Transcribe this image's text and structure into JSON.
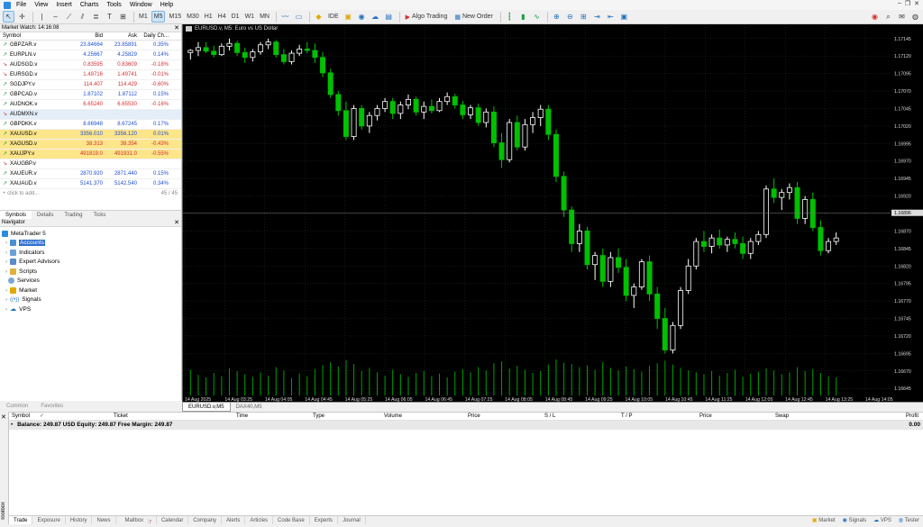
{
  "menu": [
    "File",
    "View",
    "Insert",
    "Charts",
    "Tools",
    "Window",
    "Help"
  ],
  "toolbar": {
    "timeframes": [
      "M1",
      "M5",
      "M15",
      "M30",
      "H1",
      "H4",
      "D1",
      "W1",
      "MN"
    ],
    "active_timeframe": "M5",
    "ide_label": "IDE",
    "algo_label": "Algo Trading",
    "neworder_label": "New Order"
  },
  "market_watch": {
    "title": "Market Watch: 14:16:08",
    "headers": {
      "symbol": "Symbol",
      "bid": "Bid",
      "ask": "Ask",
      "change": "Daily Ch..."
    },
    "rows": [
      {
        "symbol": "GBPZAR.v",
        "bid": "23.84664",
        "ask": "23.85891",
        "change": "0.35%",
        "dir": "up",
        "style": ""
      },
      {
        "symbol": "EURPLN.v",
        "bid": "4.25667",
        "ask": "4.25829",
        "change": "0.14%",
        "dir": "up",
        "style": ""
      },
      {
        "symbol": "AUDSGD.v",
        "bid": "0.83595",
        "ask": "0.83609",
        "change": "-0.18%",
        "dir": "dn",
        "style": ""
      },
      {
        "symbol": "EURSGD.v",
        "bid": "1.49716",
        "ask": "1.49741",
        "change": "-0.01%",
        "dir": "dn",
        "style": ""
      },
      {
        "symbol": "SGDJPY.v",
        "bid": "114.407",
        "ask": "114.429",
        "change": "-0.60%",
        "dir": "up",
        "style": ""
      },
      {
        "symbol": "GBPCAD.v",
        "bid": "1.87102",
        "ask": "1.87112",
        "change": "0.15%",
        "dir": "up",
        "style": ""
      },
      {
        "symbol": "AUDNOK.v",
        "bid": "6.65240",
        "ask": "6.65530",
        "change": "-0.16%",
        "dir": "up",
        "style": ""
      },
      {
        "symbol": "AUDMXN.v",
        "bid": "",
        "ask": "",
        "change": "",
        "dir": "dn",
        "style": "b"
      },
      {
        "symbol": "GBPDKK.v",
        "bid": "8.66948",
        "ask": "8.67245",
        "change": "0.17%",
        "dir": "up",
        "style": ""
      },
      {
        "symbol": "XAUUSD.v",
        "bid": "3356.010",
        "ask": "3356.120",
        "change": "0.01%",
        "dir": "up",
        "style": "y"
      },
      {
        "symbol": "XAGUSD.v",
        "bid": "38.313",
        "ask": "38.354",
        "change": "-0.43%",
        "dir": "up",
        "style": "y"
      },
      {
        "symbol": "XAUJPY.v",
        "bid": "491819.0",
        "ask": "491931.0",
        "change": "-0.55%",
        "dir": "up",
        "style": "y"
      },
      {
        "symbol": "XAUGBP.v",
        "bid": "",
        "ask": "",
        "change": "",
        "dir": "dn",
        "style": ""
      },
      {
        "symbol": "XAUEUR.v",
        "bid": "2870.920",
        "ask": "2871.440",
        "change": "0.15%",
        "dir": "up",
        "style": ""
      },
      {
        "symbol": "XAUAUD.v",
        "bid": "5141.370",
        "ask": "5142.540",
        "change": "0.34%",
        "dir": "up",
        "style": ""
      }
    ],
    "add_label": "click to add...",
    "count": "45 / 45",
    "tabs": [
      "Symbols",
      "Details",
      "Trading",
      "Ticks"
    ]
  },
  "navigator": {
    "title": "Navigator",
    "root": "MetaTrader 5",
    "items": [
      "Accounts",
      "Indicators",
      "Expert Advisors",
      "Scripts",
      "Services",
      "Market",
      "Signals",
      "VPS"
    ]
  },
  "left_tabs": [
    "Common",
    "Favorites"
  ],
  "chart": {
    "title": "EURUSD.v, M5:  Euro vs US Dollar",
    "price_labels": [
      "1.17145",
      "1.17120",
      "1.17095",
      "1.17070",
      "1.17045",
      "1.17020",
      "1.16995",
      "1.16970",
      "1.16945",
      "1.16920",
      "1.16895",
      "1.16870",
      "1.16845",
      "1.16820",
      "1.16795",
      "1.16770",
      "1.16745",
      "1.16720",
      "1.16695",
      "1.16670",
      "1.16645"
    ],
    "current_price": "1.16896",
    "time_labels": [
      "14 Aug 2025",
      "14 Aug 03:25",
      "14 Aug 04:05",
      "14 Aug 04:45",
      "14 Aug 05:25",
      "14 Aug 06:05",
      "14 Aug 06:45",
      "14 Aug 07:25",
      "14 Aug 08:05",
      "14 Aug 08:45",
      "14 Aug 09:25",
      "14 Aug 10:05",
      "14 Aug 10:45",
      "14 Aug 11:25",
      "14 Aug 12:05",
      "14 Aug 12:45",
      "14 Aug 13:25",
      "14 Aug 14:05"
    ],
    "tabs": [
      "EURUSD.v,M5",
      "DAX40,M5"
    ],
    "candles": [
      [
        1.17125,
        1.1713,
        1.17115,
        1.17128
      ],
      [
        1.17128,
        1.1714,
        1.1712,
        1.17132
      ],
      [
        1.17132,
        1.1714,
        1.17124,
        1.17127
      ],
      [
        1.17127,
        1.17135,
        1.17118,
        1.17122
      ],
      [
        1.17122,
        1.17138,
        1.1712,
        1.17134
      ],
      [
        1.17134,
        1.17145,
        1.17128,
        1.17138
      ],
      [
        1.17138,
        1.17142,
        1.1712,
        1.17125
      ],
      [
        1.17125,
        1.17132,
        1.1711,
        1.17118
      ],
      [
        1.17118,
        1.1713,
        1.17112,
        1.17126
      ],
      [
        1.17126,
        1.1714,
        1.17122,
        1.17136
      ],
      [
        1.17136,
        1.17145,
        1.1713,
        1.1714
      ],
      [
        1.1714,
        1.17143,
        1.17118,
        1.17122
      ],
      [
        1.17122,
        1.1713,
        1.17108,
        1.17112
      ],
      [
        1.17112,
        1.17128,
        1.17108,
        1.17124
      ],
      [
        1.17124,
        1.17136,
        1.1712,
        1.1713
      ],
      [
        1.1713,
        1.1714,
        1.17124,
        1.17128
      ],
      [
        1.17128,
        1.17138,
        1.1711,
        1.17118
      ],
      [
        1.17118,
        1.17126,
        1.1709,
        1.17096
      ],
      [
        1.17096,
        1.17102,
        1.1706,
        1.17065
      ],
      [
        1.17065,
        1.1707,
        1.17035,
        1.17042
      ],
      [
        1.17042,
        1.17055,
        1.17,
        1.17005
      ],
      [
        1.17005,
        1.1705,
        1.17,
        1.17045
      ],
      [
        1.17045,
        1.1705,
        1.17015,
        1.1702
      ],
      [
        1.1702,
        1.1704,
        1.1701,
        1.17035
      ],
      [
        1.17035,
        1.1705,
        1.17028,
        1.17045
      ],
      [
        1.17045,
        1.1706,
        1.1704,
        1.17055
      ],
      [
        1.17055,
        1.1706,
        1.1703,
        1.17038
      ],
      [
        1.17038,
        1.17055,
        1.1703,
        1.1705
      ],
      [
        1.1705,
        1.17065,
        1.17044,
        1.17058
      ],
      [
        1.17058,
        1.17062,
        1.17035,
        1.1704
      ],
      [
        1.1704,
        1.17055,
        1.1703,
        1.17048
      ],
      [
        1.17048,
        1.17058,
        1.17038,
        1.17042
      ],
      [
        1.17042,
        1.1706,
        1.1704,
        1.17055
      ],
      [
        1.17055,
        1.17068,
        1.1705,
        1.17062
      ],
      [
        1.17062,
        1.17066,
        1.17045,
        1.1705
      ],
      [
        1.1705,
        1.17056,
        1.1703,
        1.17036
      ],
      [
        1.17036,
        1.1705,
        1.1703,
        1.17046
      ],
      [
        1.17046,
        1.17052,
        1.1702,
        1.17025
      ],
      [
        1.17025,
        1.17045,
        1.17018,
        1.1704
      ],
      [
        1.1704,
        1.17048,
        1.1699,
        1.16996
      ],
      [
        1.16996,
        1.1701,
        1.1696,
        1.16972
      ],
      [
        1.16972,
        1.1703,
        1.16968,
        1.17025
      ],
      [
        1.17025,
        1.17035,
        1.16985,
        1.1699
      ],
      [
        1.1699,
        1.1703,
        1.16985,
        1.17022
      ],
      [
        1.17022,
        1.1704,
        1.1701,
        1.17032
      ],
      [
        1.17032,
        1.1705,
        1.1702,
        1.17044
      ],
      [
        1.17044,
        1.1705,
        1.17,
        1.17008
      ],
      [
        1.17008,
        1.17015,
        1.1694,
        1.16948
      ],
      [
        1.16948,
        1.16955,
        1.1689,
        1.169
      ],
      [
        1.169,
        1.16905,
        1.1684,
        1.16852
      ],
      [
        1.16852,
        1.1688,
        1.1684,
        1.1687
      ],
      [
        1.1687,
        1.16876,
        1.16815,
        1.16822
      ],
      [
        1.16822,
        1.1684,
        1.168,
        1.16835
      ],
      [
        1.16835,
        1.16845,
        1.1679,
        1.16798
      ],
      [
        1.16798,
        1.1684,
        1.1679,
        1.16832
      ],
      [
        1.16832,
        1.16845,
        1.1681,
        1.16818
      ],
      [
        1.16818,
        1.1683,
        1.1677,
        1.16778
      ],
      [
        1.16778,
        1.16795,
        1.1676,
        1.1679
      ],
      [
        1.1679,
        1.1683,
        1.16786,
        1.16826
      ],
      [
        1.16826,
        1.16835,
        1.1677,
        1.1678
      ],
      [
        1.1678,
        1.1679,
        1.1673,
        1.16745
      ],
      [
        1.16745,
        1.1676,
        1.16695,
        1.167
      ],
      [
        1.167,
        1.1674,
        1.16695,
        1.16735
      ],
      [
        1.16735,
        1.1679,
        1.1673,
        1.16785
      ],
      [
        1.16785,
        1.1683,
        1.1678,
        1.1682
      ],
      [
        1.1682,
        1.1686,
        1.16815,
        1.16855
      ],
      [
        1.16855,
        1.1687,
        1.1684,
        1.16848
      ],
      [
        1.16848,
        1.16865,
        1.16838,
        1.1686
      ],
      [
        1.1686,
        1.16872,
        1.16845,
        1.1685
      ],
      [
        1.1685,
        1.16862,
        1.1684,
        1.16858
      ],
      [
        1.16858,
        1.16868,
        1.16845,
        1.16852
      ],
      [
        1.16852,
        1.16862,
        1.1683,
        1.16838
      ],
      [
        1.16838,
        1.1686,
        1.1683,
        1.16855
      ],
      [
        1.16855,
        1.1687,
        1.1685,
        1.16865
      ],
      [
        1.16865,
        1.16935,
        1.1686,
        1.1693
      ],
      [
        1.1693,
        1.16945,
        1.1691,
        1.16918
      ],
      [
        1.16918,
        1.1693,
        1.169,
        1.16925
      ],
      [
        1.16925,
        1.16938,
        1.16915,
        1.16932
      ],
      [
        1.16932,
        1.1694,
        1.1688,
        1.16888
      ],
      [
        1.16888,
        1.1692,
        1.1688,
        1.16915
      ],
      [
        1.16915,
        1.16925,
        1.1687,
        1.16875
      ],
      [
        1.16875,
        1.16885,
        1.16835,
        1.16842
      ],
      [
        1.16842,
        1.1686,
        1.16838,
        1.16855
      ],
      [
        1.16855,
        1.16868,
        1.1685,
        1.1686
      ]
    ],
    "volumes": [
      40,
      32,
      28,
      35,
      30,
      42,
      38,
      33,
      29,
      36,
      31,
      44,
      39,
      27,
      34,
      30,
      41,
      47,
      52,
      45,
      55,
      49,
      38,
      43,
      36,
      31,
      40,
      33,
      29,
      35,
      38,
      30,
      34,
      28,
      37,
      41,
      36,
      44,
      39,
      50,
      53,
      42,
      46,
      40,
      35,
      38,
      48,
      56,
      51,
      49,
      44,
      47,
      40,
      52,
      43,
      39,
      45,
      41,
      37,
      46,
      50,
      54,
      48,
      43,
      39,
      36,
      33,
      38,
      31,
      35,
      40,
      29,
      34,
      37,
      42,
      39,
      33,
      36,
      44,
      38,
      41,
      35,
      30,
      28
    ],
    "colors": {
      "bull": "#ffffff",
      "bear": "#00c000",
      "grid": "#1e3a1e",
      "volume": "#00a000"
    }
  },
  "toolbox": {
    "headers": [
      "Symbol",
      "Ticket",
      "Time",
      "Type",
      "Volume",
      "Price",
      "S / L",
      "T / P",
      "Price",
      "Swap",
      "Profit"
    ],
    "balance_line": "Balance: 249.87 USD  Equity: 249.87  Free Margin: 249.87",
    "balance_value": "0.00",
    "side_label": "Toolbox",
    "tabs": [
      "Trade",
      "Exposure",
      "History",
      "News",
      "Mailbox",
      "Calendar",
      "Company",
      "Alerts",
      "Articles",
      "Code Base",
      "Experts",
      "Journal"
    ],
    "mailbox_count": "7",
    "right_items": [
      "Market",
      "Signals",
      "VPS",
      "Tester"
    ]
  }
}
